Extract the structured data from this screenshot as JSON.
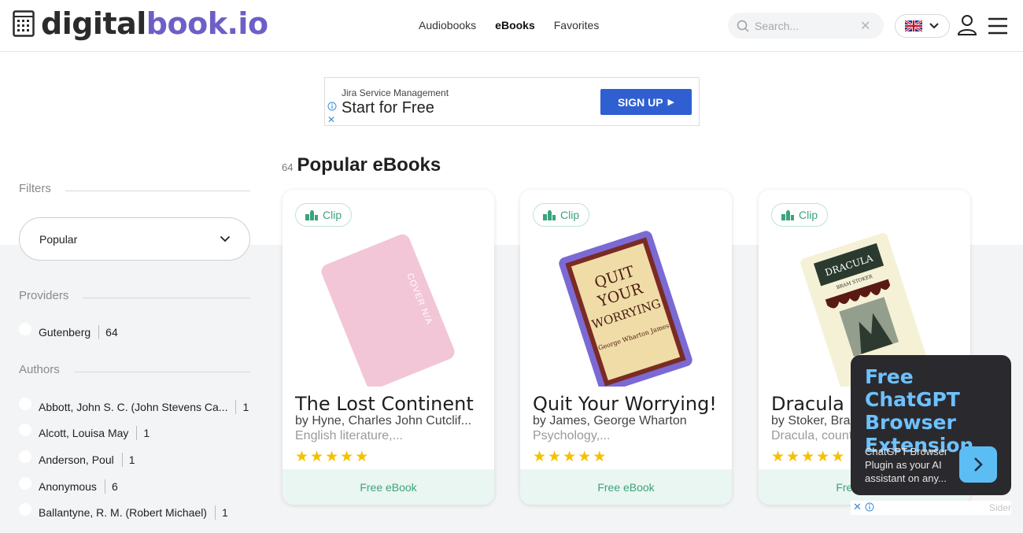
{
  "header": {
    "logo_dark": "digital",
    "logo_accent": "book.io",
    "nav": [
      {
        "label": "Audiobooks",
        "active": false
      },
      {
        "label": "eBooks",
        "active": true
      },
      {
        "label": "Favorites",
        "active": false
      }
    ],
    "search_placeholder": "Search...",
    "icons": [
      "search-icon",
      "clear-icon",
      "uk-flag-icon",
      "chevron-down-icon",
      "user-icon",
      "hamburger-menu-icon"
    ]
  },
  "ad": {
    "brand": "Jira Service Management",
    "headline": "Start for Free",
    "cta": "SIGN UP"
  },
  "sidebar": {
    "filters_label": "Filters",
    "sort_value": "Popular",
    "providers_label": "Providers",
    "providers": [
      {
        "name": "Gutenberg",
        "count": "64"
      }
    ],
    "authors_label": "Authors",
    "authors": [
      {
        "name": "Abbott, John S. C. (John Stevens Ca...",
        "count": "1"
      },
      {
        "name": "Alcott, Louisa May",
        "count": "1"
      },
      {
        "name": "Anderson, Poul",
        "count": "1"
      },
      {
        "name": "Anonymous",
        "count": "6"
      },
      {
        "name": "Ballantyne, R. M. (Robert Michael)",
        "count": "1"
      }
    ]
  },
  "main": {
    "count": "64",
    "title": "Popular eBooks",
    "books": [
      {
        "clip": "Clip",
        "title": "The Lost Continent",
        "author": "by Hyne, Charles John Cutclif...",
        "genre": "English literature,...",
        "rating": 5,
        "footer": "Free eBook",
        "cover_text": "COVER N/A"
      },
      {
        "clip": "Clip",
        "title": "Quit Your Worrying!",
        "author": "by James, George Wharton",
        "genre": "Psychology,...",
        "rating": 5,
        "footer": "Free eBook",
        "cover_title": "QUIT YOUR WORRYING",
        "cover_author": "George Wharton James"
      },
      {
        "clip": "Clip",
        "title": "Dracula",
        "author": "by Stoker, Bram",
        "genre": "Dracula, count...",
        "rating": 5,
        "footer": "Free eBook",
        "cover_title": "DRACULA",
        "cover_author": "BRAM STOKER"
      }
    ]
  },
  "sider_popup": {
    "headline": "Free ChatGPT Browser Extension",
    "desc": "ChatGPT Browser Plugin as your AI assistant on any...",
    "brand": "Sider"
  },
  "colors": {
    "accent": "#6c5fc7",
    "green": "#3aa47c",
    "star": "#f2c200",
    "ad_button": "#2f5fd1",
    "sider_bg": "#2a2a2e",
    "sider_headline": "#6ec1ff"
  }
}
